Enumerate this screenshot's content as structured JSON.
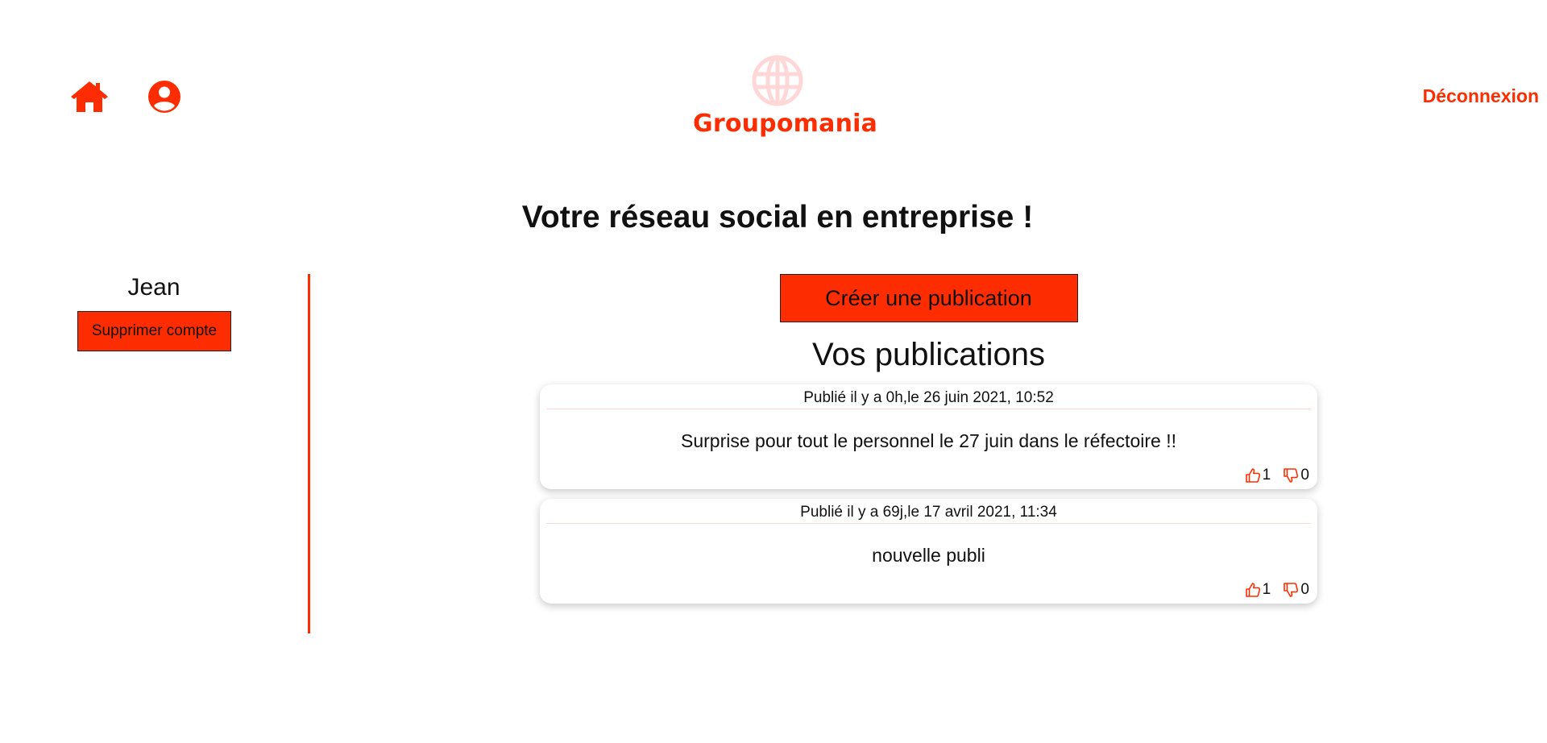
{
  "brand": {
    "name": "Groupomania",
    "accent": "#fd2d01"
  },
  "header": {
    "logout_label": "Déconnexion"
  },
  "tagline": "Votre réseau social en entreprise !",
  "sidebar": {
    "username": "Jean",
    "delete_label": "Supprimer compte"
  },
  "main": {
    "create_label": "Créer une publication",
    "section_title": "Vos publications",
    "posts": [
      {
        "meta": "Publié il y a 0h,le 26 juin 2021, 10:52",
        "content": "Surprise pour tout le personnel le 27 juin dans le réfectoire !!",
        "likes": "1",
        "dislikes": "0"
      },
      {
        "meta": "Publié il y a 69j,le 17 avril 2021, 11:34",
        "content": "nouvelle publi",
        "likes": "1",
        "dislikes": "0"
      }
    ]
  },
  "icons": {
    "home": "home-icon",
    "profile": "user-icon",
    "logo": "globe-icon",
    "like": "thumbs-up-icon",
    "dislike": "thumbs-down-icon"
  }
}
